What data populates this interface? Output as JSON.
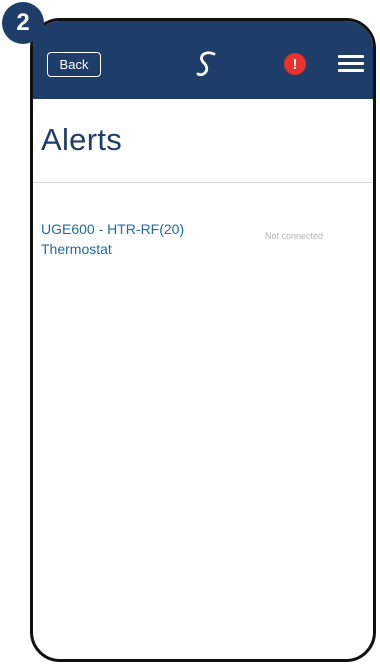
{
  "step": {
    "number": "2"
  },
  "header": {
    "back_label": "Back",
    "logo_icon": "salus-logo-icon",
    "alert_icon": "alert-icon",
    "alert_symbol": "!",
    "alert_color": "#e8322b",
    "menu_icon": "hamburger-menu-icon",
    "bar_color": "#1f3d69"
  },
  "page": {
    "title": "Alerts"
  },
  "alerts": [
    {
      "device_line1": "UGE600 - HTR-RF(20)",
      "device_line2": "Thermostat",
      "status": "Not connected"
    }
  ]
}
